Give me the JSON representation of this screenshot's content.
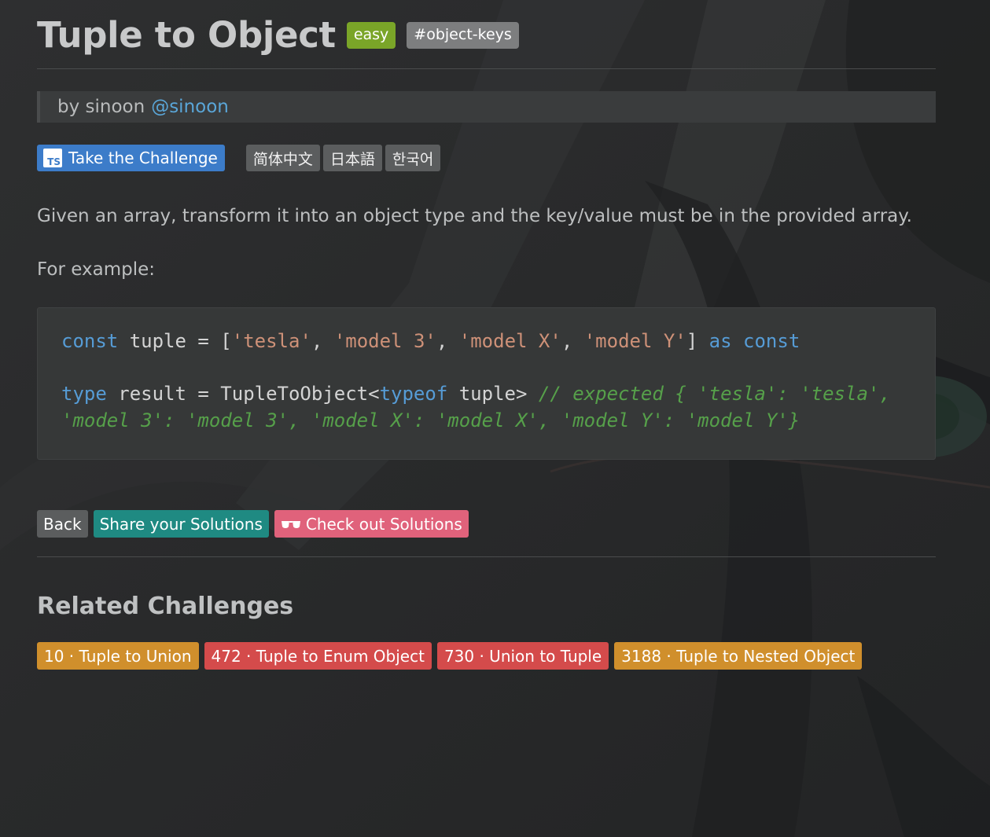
{
  "colors": {
    "background": "#2a2b2b",
    "difficulty_easy": "#7aa528",
    "tag": "#7d7e7f",
    "link": "#5aa6d8",
    "primary": "#3c7cc9",
    "share": "#1f8a82",
    "check": "#e0627b",
    "medium": "#d08f2c",
    "hard": "#d44b4b"
  },
  "header": {
    "title": "Tuple to Object",
    "difficulty": "easy",
    "tag": "#object-keys"
  },
  "author": {
    "by": "by sinoon",
    "handle": "@sinoon"
  },
  "challenge_button": {
    "icon": "ts-icon",
    "icon_text": "TS",
    "label": "Take the Challenge"
  },
  "languages": [
    "简体中文",
    "日本語",
    "한국어"
  ],
  "description": "Given an array, transform it into an object type and the key/value must be in the provided array.",
  "example_label": "For example:",
  "code": {
    "line1": {
      "kw1": "const",
      "p1": " tuple = [",
      "s1": "'tesla'",
      "p2": ", ",
      "s2": "'model 3'",
      "p3": ", ",
      "s3": "'model X'",
      "p4": ", ",
      "s4": "'model Y'",
      "p5": "] ",
      "kw2": "as",
      "p6": " ",
      "kw3": "const"
    },
    "line2": {
      "kw1": "type",
      "p1": " result = TupleToObject<",
      "kw2": "typeof",
      "p2": " tuple> ",
      "c1": "// expected { 'tesla': 'tesla',"
    },
    "line3": {
      "c1": "'model 3': 'model 3', 'model X': 'model X', 'model Y': 'model Y'}"
    }
  },
  "actions": {
    "back": "Back",
    "share": "Share your Solutions",
    "check_icon": "glasses-icon",
    "check": "Check out Solutions"
  },
  "related": {
    "title": "Related Challenges",
    "items": [
      {
        "label": "10 · Tuple to Union",
        "difficulty": "medium"
      },
      {
        "label": "472 · Tuple to Enum Object",
        "difficulty": "hard"
      },
      {
        "label": "730 · Union to Tuple",
        "difficulty": "hard"
      },
      {
        "label": "3188 · Tuple to Nested Object",
        "difficulty": "medium"
      }
    ]
  }
}
